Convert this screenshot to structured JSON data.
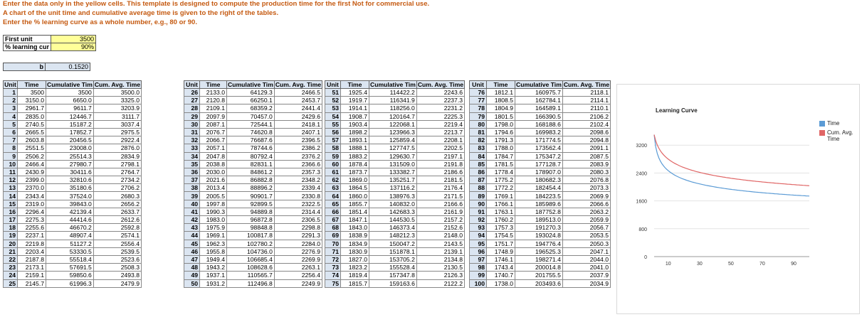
{
  "notes": {
    "line1": "Enter the data only  in the yellow cells.  This template is designed to compute the production time for the first",
    "line1_extra": "Not for commercial use.",
    "line2": "A chart of the unit time and cumulative average time is given to the right of the tables.",
    "line3": "Enter the % learning curve as a whole number, e.g., 80 or 90."
  },
  "inputs": {
    "first_unit_label": "First unit",
    "first_unit_value": "3500",
    "learning_label": "% learning cur",
    "learning_value": "90%",
    "b_label": "b",
    "b_value": "0.1520"
  },
  "headers": [
    "Unit",
    "Time",
    "Cumulative Tim",
    "Cum. Avg. Time"
  ],
  "blocks": [
    {
      "rows": [
        [
          "1",
          "3500",
          "3500",
          "3500.0"
        ],
        [
          "2",
          "3150.0",
          "6650.0",
          "3325.0"
        ],
        [
          "3",
          "2961.7",
          "9611.7",
          "3203.9"
        ],
        [
          "4",
          "2835.0",
          "12446.7",
          "3111.7"
        ],
        [
          "5",
          "2740.5",
          "15187.2",
          "3037.4"
        ],
        [
          "6",
          "2665.5",
          "17852.7",
          "2975.5"
        ],
        [
          "7",
          "2603.8",
          "20456.5",
          "2922.4"
        ],
        [
          "8",
          "2551.5",
          "23008.0",
          "2876.0"
        ],
        [
          "9",
          "2506.2",
          "25514.3",
          "2834.9"
        ],
        [
          "10",
          "2466.4",
          "27980.7",
          "2798.1"
        ],
        [
          "11",
          "2430.9",
          "30411.6",
          "2764.7"
        ],
        [
          "12",
          "2399.0",
          "32810.6",
          "2734.2"
        ],
        [
          "13",
          "2370.0",
          "35180.6",
          "2706.2"
        ],
        [
          "14",
          "2343.4",
          "37524.0",
          "2680.3"
        ],
        [
          "15",
          "2319.0",
          "39843.0",
          "2656.2"
        ],
        [
          "16",
          "2296.4",
          "42139.4",
          "2633.7"
        ],
        [
          "17",
          "2275.3",
          "44414.6",
          "2612.6"
        ],
        [
          "18",
          "2255.6",
          "46670.2",
          "2592.8"
        ],
        [
          "19",
          "2237.1",
          "48907.4",
          "2574.1"
        ],
        [
          "20",
          "2219.8",
          "51127.2",
          "2556.4"
        ],
        [
          "21",
          "2203.4",
          "53330.5",
          "2539.5"
        ],
        [
          "22",
          "2187.8",
          "55518.4",
          "2523.6"
        ],
        [
          "23",
          "2173.1",
          "57691.5",
          "2508.3"
        ],
        [
          "24",
          "2159.1",
          "59850.6",
          "2493.8"
        ],
        [
          "25",
          "2145.7",
          "61996.3",
          "2479.9"
        ]
      ]
    },
    {
      "rows": [
        [
          "26",
          "2133.0",
          "64129.3",
          "2466.5"
        ],
        [
          "27",
          "2120.8",
          "66250.1",
          "2453.7"
        ],
        [
          "28",
          "2109.1",
          "68359.2",
          "2441.4"
        ],
        [
          "29",
          "2097.9",
          "70457.0",
          "2429.6"
        ],
        [
          "30",
          "2087.1",
          "72544.1",
          "2418.1"
        ],
        [
          "31",
          "2076.7",
          "74620.8",
          "2407.1"
        ],
        [
          "32",
          "2066.7",
          "76687.6",
          "2396.5"
        ],
        [
          "33",
          "2057.1",
          "78744.6",
          "2386.2"
        ],
        [
          "34",
          "2047.8",
          "80792.4",
          "2376.2"
        ],
        [
          "35",
          "2038.8",
          "82831.1",
          "2366.6"
        ],
        [
          "36",
          "2030.0",
          "84861.2",
          "2357.3"
        ],
        [
          "37",
          "2021.6",
          "86882.8",
          "2348.2"
        ],
        [
          "38",
          "2013.4",
          "88896.2",
          "2339.4"
        ],
        [
          "39",
          "2005.5",
          "90901.7",
          "2330.8"
        ],
        [
          "40",
          "1997.8",
          "92899.5",
          "2322.5"
        ],
        [
          "41",
          "1990.3",
          "94889.8",
          "2314.4"
        ],
        [
          "42",
          "1983.0",
          "96872.8",
          "2306.5"
        ],
        [
          "43",
          "1975.9",
          "98848.8",
          "2298.8"
        ],
        [
          "44",
          "1969.1",
          "100817.8",
          "2291.3"
        ],
        [
          "45",
          "1962.3",
          "102780.2",
          "2284.0"
        ],
        [
          "46",
          "1955.8",
          "104736.0",
          "2276.9"
        ],
        [
          "47",
          "1949.4",
          "106685.4",
          "2269.9"
        ],
        [
          "48",
          "1943.2",
          "108628.6",
          "2263.1"
        ],
        [
          "49",
          "1937.1",
          "110565.7",
          "2256.4"
        ],
        [
          "50",
          "1931.2",
          "112496.8",
          "2249.9"
        ]
      ]
    },
    {
      "rows": [
        [
          "51",
          "1925.4",
          "114422.2",
          "2243.6"
        ],
        [
          "52",
          "1919.7",
          "116341.9",
          "2237.3"
        ],
        [
          "53",
          "1914.1",
          "118256.0",
          "2231.2"
        ],
        [
          "54",
          "1908.7",
          "120164.7",
          "2225.3"
        ],
        [
          "55",
          "1903.4",
          "122068.1",
          "2219.4"
        ],
        [
          "56",
          "1898.2",
          "123966.3",
          "2213.7"
        ],
        [
          "57",
          "1893.1",
          "125859.4",
          "2208.1"
        ],
        [
          "58",
          "1888.1",
          "127747.5",
          "2202.5"
        ],
        [
          "59",
          "1883.2",
          "129630.7",
          "2197.1"
        ],
        [
          "60",
          "1878.4",
          "131509.0",
          "2191.8"
        ],
        [
          "61",
          "1873.7",
          "133382.7",
          "2186.6"
        ],
        [
          "62",
          "1869.0",
          "135251.7",
          "2181.5"
        ],
        [
          "63",
          "1864.5",
          "137116.2",
          "2176.4"
        ],
        [
          "64",
          "1860.0",
          "138976.3",
          "2171.5"
        ],
        [
          "65",
          "1855.7",
          "140832.0",
          "2166.6"
        ],
        [
          "66",
          "1851.4",
          "142683.3",
          "2161.9"
        ],
        [
          "67",
          "1847.1",
          "144530.5",
          "2157.2"
        ],
        [
          "68",
          "1843.0",
          "146373.4",
          "2152.6"
        ],
        [
          "69",
          "1838.9",
          "148212.3",
          "2148.0"
        ],
        [
          "70",
          "1834.9",
          "150047.2",
          "2143.5"
        ],
        [
          "71",
          "1830.9",
          "151878.1",
          "2139.1"
        ],
        [
          "72",
          "1827.0",
          "153705.2",
          "2134.8"
        ],
        [
          "73",
          "1823.2",
          "155528.4",
          "2130.5"
        ],
        [
          "74",
          "1819.4",
          "157347.8",
          "2126.3"
        ],
        [
          "75",
          "1815.7",
          "159163.6",
          "2122.2"
        ]
      ]
    },
    {
      "rows": [
        [
          "76",
          "1812.1",
          "160975.7",
          "2118.1"
        ],
        [
          "77",
          "1808.5",
          "162784.1",
          "2114.1"
        ],
        [
          "78",
          "1804.9",
          "164589.1",
          "2110.1"
        ],
        [
          "79",
          "1801.5",
          "166390.5",
          "2106.2"
        ],
        [
          "80",
          "1798.0",
          "168188.6",
          "2102.4"
        ],
        [
          "81",
          "1794.6",
          "169983.2",
          "2098.6"
        ],
        [
          "82",
          "1791.3",
          "171774.5",
          "2094.8"
        ],
        [
          "83",
          "1788.0",
          "173562.4",
          "2091.1"
        ],
        [
          "84",
          "1784.7",
          "175347.2",
          "2087.5"
        ],
        [
          "85",
          "1781.5",
          "177128.7",
          "2083.9"
        ],
        [
          "86",
          "1778.4",
          "178907.0",
          "2080.3"
        ],
        [
          "87",
          "1775.2",
          "180682.3",
          "2076.8"
        ],
        [
          "88",
          "1772.2",
          "182454.4",
          "2073.3"
        ],
        [
          "89",
          "1769.1",
          "184223.5",
          "2069.9"
        ],
        [
          "90",
          "1766.1",
          "185989.6",
          "2066.6"
        ],
        [
          "91",
          "1763.1",
          "187752.8",
          "2063.2"
        ],
        [
          "92",
          "1760.2",
          "189513.0",
          "2059.9"
        ],
        [
          "93",
          "1757.3",
          "191270.3",
          "2056.7"
        ],
        [
          "94",
          "1754.5",
          "193024.8",
          "2053.5"
        ],
        [
          "95",
          "1751.7",
          "194776.4",
          "2050.3"
        ],
        [
          "96",
          "1748.9",
          "196525.3",
          "2047.1"
        ],
        [
          "97",
          "1746.1",
          "198271.4",
          "2044.0"
        ],
        [
          "98",
          "1743.4",
          "200014.8",
          "2041.0"
        ],
        [
          "99",
          "1740.7",
          "201755.5",
          "2037.9"
        ],
        [
          "100",
          "1738.0",
          "203493.6",
          "2034.9"
        ]
      ]
    }
  ],
  "chart_data": {
    "type": "line",
    "title": "Learning Curve",
    "first_unit": 3500,
    "learning_rate": 0.9,
    "b": 0.152,
    "x_ticks": [
      10,
      30,
      50,
      70,
      90
    ],
    "y_ticks": [
      0,
      800,
      1600,
      2400,
      3200
    ],
    "xlim": [
      1,
      100
    ],
    "ylim": [
      0,
      4000
    ],
    "grid": true,
    "legend_position": "right",
    "series": [
      {
        "name": "Time",
        "color": "#5b9bd5",
        "values": [
          3500,
          3150.0,
          2961.7,
          2835.0,
          2740.5,
          2665.5,
          2603.8,
          2551.5,
          2506.2,
          2466.4,
          2430.9,
          2399.0,
          2370.0,
          2343.4,
          2319.0,
          2296.4,
          2275.3,
          2255.6,
          2237.1,
          2219.8,
          2203.4,
          2187.8,
          2173.1,
          2159.1,
          2145.7,
          2133.0,
          2120.8,
          2109.1,
          2097.9,
          2087.1,
          2076.7,
          2066.7,
          2057.1,
          2047.8,
          2038.8,
          2030.0,
          2021.6,
          2013.4,
          2005.5,
          1997.8,
          1990.3,
          1983.0,
          1975.9,
          1969.1,
          1962.3,
          1955.8,
          1949.4,
          1943.2,
          1937.1,
          1931.2,
          1925.4,
          1919.7,
          1914.1,
          1908.7,
          1903.4,
          1898.2,
          1893.1,
          1888.1,
          1883.2,
          1878.4,
          1873.7,
          1869.0,
          1864.5,
          1860.0,
          1855.7,
          1851.4,
          1847.1,
          1843.0,
          1838.9,
          1834.9,
          1830.9,
          1827.0,
          1823.2,
          1819.4,
          1815.7,
          1812.1,
          1808.5,
          1804.9,
          1801.5,
          1798.0,
          1794.6,
          1791.3,
          1788.0,
          1784.7,
          1781.5,
          1778.4,
          1775.2,
          1772.2,
          1769.1,
          1766.1,
          1763.1,
          1760.2,
          1757.3,
          1754.5,
          1751.7,
          1748.9,
          1746.1,
          1743.4,
          1740.7,
          1738.0
        ]
      },
      {
        "name": "Cum. Avg. Time",
        "color": "#e06666",
        "values": [
          3500.0,
          3325.0,
          3203.9,
          3111.7,
          3037.4,
          2975.5,
          2922.4,
          2876.0,
          2834.9,
          2798.1,
          2764.7,
          2734.2,
          2706.2,
          2680.3,
          2656.2,
          2633.7,
          2612.6,
          2592.8,
          2574.1,
          2556.4,
          2539.5,
          2523.6,
          2508.3,
          2493.8,
          2479.9,
          2466.5,
          2453.7,
          2441.4,
          2429.6,
          2418.1,
          2407.1,
          2396.5,
          2386.2,
          2376.2,
          2366.6,
          2357.3,
          2348.2,
          2339.4,
          2330.8,
          2322.5,
          2314.4,
          2306.5,
          2298.8,
          2291.3,
          2284.0,
          2276.9,
          2269.9,
          2263.1,
          2256.4,
          2249.9,
          2243.6,
          2237.3,
          2231.2,
          2225.3,
          2219.4,
          2213.7,
          2208.1,
          2202.5,
          2197.1,
          2191.8,
          2186.6,
          2181.5,
          2176.4,
          2171.5,
          2166.6,
          2161.9,
          2157.2,
          2152.6,
          2148.0,
          2143.5,
          2139.1,
          2134.8,
          2130.5,
          2126.3,
          2122.2,
          2118.1,
          2114.1,
          2110.1,
          2106.2,
          2102.4,
          2098.6,
          2094.8,
          2091.1,
          2087.5,
          2083.9,
          2080.3,
          2076.8,
          2073.3,
          2069.9,
          2066.6,
          2063.2,
          2059.9,
          2056.7,
          2053.5,
          2050.3,
          2047.1,
          2044.0,
          2041.0,
          2037.9,
          2034.9
        ]
      }
    ]
  }
}
